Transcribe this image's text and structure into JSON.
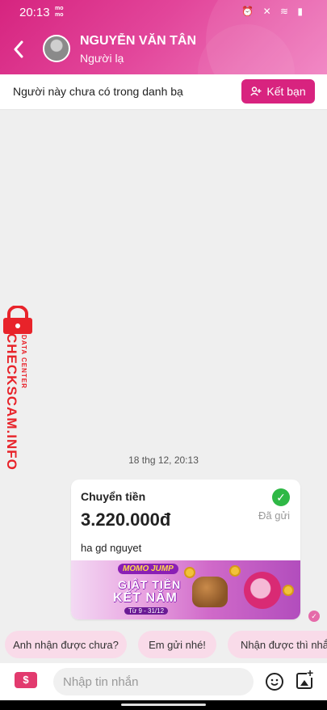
{
  "status_bar": {
    "time": "20:13",
    "app_badge": "mo\nmo",
    "icons": "⏰ ✕ ≋ ▮"
  },
  "header": {
    "contact_name": "NGUYỄN VĂN TÂN",
    "contact_subtitle": "Người lạ"
  },
  "notice": {
    "text": "Người này chưa có trong danh bạ",
    "add_friend_label": "Kết bạn"
  },
  "watermark": {
    "main": "CHECKSCAM.INFO",
    "sub": "DATA CENTER"
  },
  "chat": {
    "timestamp": "18 thg 12, 20:13",
    "transfer": {
      "title": "Chuyển tiền",
      "amount": "3.220.000đ",
      "status": "Đã gửi",
      "note": "ha gd nguyet",
      "banner": {
        "logo": "MOMO JUMP",
        "line1": "GIẬT TIỀN",
        "line2": "KẾT NĂM",
        "dates": "Từ 9 - 31/12"
      }
    }
  },
  "quick_replies": [
    "Anh nhận được chưa?",
    "Em gửi nhé!",
    "Nhận được thì nhắn"
  ],
  "composer": {
    "placeholder": "Nhập tin nhắn",
    "money_icon_label": "$"
  },
  "colors": {
    "brand": "#d8237f",
    "chip_bg": "#f9dbe9",
    "success": "#2eb845",
    "watermark": "#e8232a"
  }
}
